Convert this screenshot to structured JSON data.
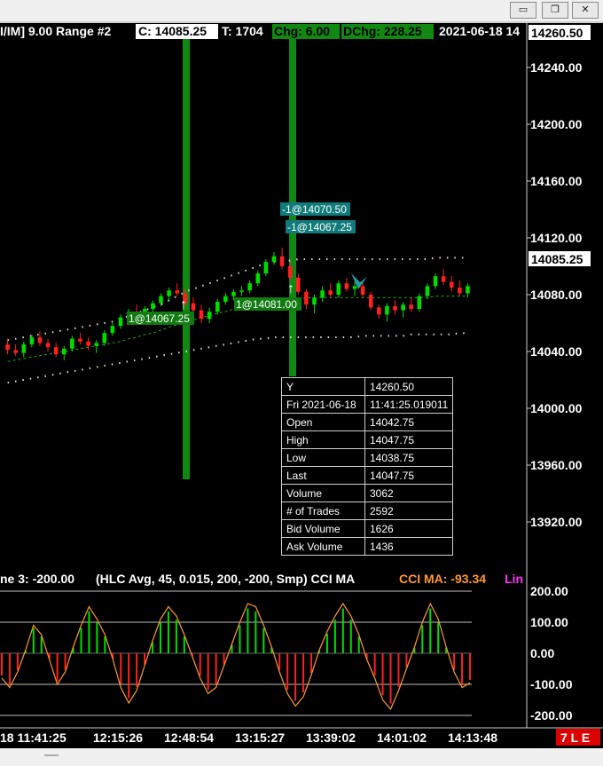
{
  "window": {
    "minimize_glyph": "▭",
    "restore_glyph": "❐",
    "close_glyph": "✕"
  },
  "header": {
    "title": "I/IM]  9.00 Range #2",
    "close": "C: 14085.25",
    "trades": "T: 1704",
    "chg": "Chg: 6.00",
    "dchg": "DChg: 228.25",
    "date": "2021-06-18 14"
  },
  "price_axis": {
    "ticks": [
      "14240.00",
      "14200.00",
      "14160.00",
      "14120.00",
      "14080.00",
      "14040.00",
      "14000.00",
      "13960.00",
      "13920.00"
    ],
    "top_label": "14260.50",
    "last_label": "14085.25"
  },
  "markers": {
    "sell_1": "-1@14070.50",
    "sell_2": "-1@14067.25",
    "buy_1": "1@14067.25",
    "buy_2": "1@14081.00"
  },
  "tooltip": {
    "rows": [
      [
        "Y",
        "14260.50"
      ],
      [
        "Fri 2021-06-18",
        "11:41:25.019011"
      ],
      [
        "Open",
        "14042.75"
      ],
      [
        "High",
        "14047.75"
      ],
      [
        "Low",
        "14038.75"
      ],
      [
        "Last",
        "14047.75"
      ],
      [
        "Volume",
        "3062"
      ],
      [
        "# of Trades",
        "2592"
      ],
      [
        "Bid Volume",
        "1626"
      ],
      [
        "Ask Volume",
        "1436"
      ]
    ]
  },
  "indicator": {
    "line3": "ne 3: -200.00",
    "params": "(HLC Avg, 45, 0.015, 200, -200, Smp)  CCI MA",
    "cci_ma": "CCI MA: -93.34",
    "lin": "Lin",
    "ticks": [
      "200.00",
      "100.00",
      "0.00",
      "-100.00",
      "-200.00"
    ]
  },
  "time_axis": {
    "labels": [
      "18  11:41:25",
      "12:15:26",
      "12:48:54",
      "13:15:27",
      "13:39:02",
      "14:01:02",
      "14:13:48"
    ]
  },
  "badge": "7 L E",
  "colors": {
    "up": "#00dd00",
    "down": "#ff2020",
    "highlight_bar": "#118811",
    "marker_sell": "#117a7a",
    "marker_buy": "#117a11",
    "cci_line": "#ff9933",
    "grid": "#c0c0c0"
  },
  "chart_data": {
    "type": "candlestick",
    "price_range": [
      13900,
      14270
    ],
    "cci_range": [
      -200,
      200
    ],
    "price_ticks": [
      14240,
      14200,
      14160,
      14120,
      14080,
      14040,
      14000,
      13960,
      13920
    ],
    "cci_ticks": [
      200,
      100,
      0,
      -100,
      -200
    ],
    "candles": [
      [
        14045,
        14049,
        14038,
        14041
      ],
      [
        14041,
        14045,
        14037,
        14039
      ],
      [
        14039,
        14047,
        14036,
        14045
      ],
      [
        14045,
        14052,
        14043,
        14050
      ],
      [
        14050,
        14054,
        14044,
        14046
      ],
      [
        14046,
        14049,
        14040,
        14043
      ],
      [
        14043,
        14046,
        14036,
        14038
      ],
      [
        14038,
        14044,
        14034,
        14042
      ],
      [
        14042,
        14051,
        14040,
        14049
      ],
      [
        14049,
        14053,
        14045,
        14047
      ],
      [
        14047,
        14050,
        14041,
        14044
      ],
      [
        14044,
        14048,
        14039,
        14046
      ],
      [
        14046,
        14055,
        14044,
        14053
      ],
      [
        14053,
        14060,
        14051,
        14058
      ],
      [
        14058,
        14066,
        14056,
        14064
      ],
      [
        14064,
        14070,
        14061,
        14068
      ],
      [
        14068,
        14073,
        14063,
        14066
      ],
      [
        14066,
        14072,
        14064,
        14070
      ],
      [
        14070,
        14076,
        14068,
        14074
      ],
      [
        14074,
        14081,
        14072,
        14079
      ],
      [
        14079,
        14085,
        14076,
        14083
      ],
      [
        14083,
        14088,
        14079,
        14081
      ],
      [
        14081,
        14084,
        14072,
        14074
      ],
      [
        14074,
        14078,
        14066,
        14069
      ],
      [
        14069,
        14073,
        14060,
        14063
      ],
      [
        14063,
        14071,
        14060,
        14068
      ],
      [
        14068,
        14077,
        14066,
        14075
      ],
      [
        14075,
        14081,
        14073,
        14079
      ],
      [
        14079,
        14084,
        14076,
        14082
      ],
      [
        14082,
        14086,
        14079,
        14083
      ],
      [
        14083,
        14090,
        14081,
        14088
      ],
      [
        14088,
        14097,
        14086,
        14095
      ],
      [
        14095,
        14105,
        14093,
        14103
      ],
      [
        14103,
        14110,
        14101,
        14107
      ],
      [
        14107,
        14113,
        14098,
        14100
      ],
      [
        14100,
        14103,
        14090,
        14092
      ],
      [
        14092,
        14095,
        14080,
        14082
      ],
      [
        14082,
        14084,
        14070,
        14073
      ],
      [
        14073,
        14080,
        14067,
        14078
      ],
      [
        14078,
        14086,
        14075,
        14083
      ],
      [
        14083,
        14088,
        14078,
        14080
      ],
      [
        14080,
        14090,
        14078,
        14088
      ],
      [
        14088,
        14092,
        14082,
        14084
      ],
      [
        14084,
        14089,
        14079,
        14086
      ],
      [
        14086,
        14090,
        14078,
        14080
      ],
      [
        14080,
        14082,
        14069,
        14071
      ],
      [
        14071,
        14073,
        14063,
        14066
      ],
      [
        14066,
        14074,
        14061,
        14072
      ],
      [
        14072,
        14076,
        14066,
        14069
      ],
      [
        14069,
        14075,
        14064,
        14073
      ],
      [
        14073,
        14078,
        14068,
        14070
      ],
      [
        14070,
        14081,
        14068,
        14079
      ],
      [
        14079,
        14088,
        14077,
        14086
      ],
      [
        14086,
        14095,
        14084,
        14093
      ],
      [
        14093,
        14098,
        14087,
        14089
      ],
      [
        14089,
        14093,
        14082,
        14085
      ],
      [
        14085,
        14090,
        14079,
        14081
      ],
      [
        14081,
        14088,
        14078,
        14086
      ]
    ],
    "upper_band": [
      14048,
      14049,
      14050,
      14051,
      14052,
      14053,
      14054,
      14055,
      14056,
      14057,
      14058,
      14059,
      14060,
      14061,
      14063,
      14065,
      14067,
      14069,
      14071,
      14073,
      14076,
      14079,
      14082,
      14084,
      14086,
      14088,
      14090,
      14092,
      14094,
      14096,
      14098,
      14100,
      14102,
      14103,
      14104,
      14104,
      14105,
      14105,
      14105,
      14105,
      14105,
      14105,
      14105,
      14105,
      14105,
      14105,
      14105,
      14105,
      14105,
      14105,
      14105,
      14105,
      14105,
      14106,
      14106,
      14106,
      14106,
      14106
    ],
    "lower_band": [
      14018,
      14019,
      14020,
      14021,
      14022,
      14023,
      14024,
      14025,
      14026,
      14027,
      14028,
      14029,
      14030,
      14031,
      14032,
      14033,
      14034,
      14035,
      14036,
      14037,
      14038,
      14039,
      14040,
      14041,
      14042,
      14043,
      14044,
      14045,
      14046,
      14047,
      14048,
      14049,
      14049,
      14050,
      14050,
      14050,
      14050,
      14050,
      14050,
      14050,
      14050,
      14050,
      14050,
      14050,
      14051,
      14051,
      14051,
      14051,
      14051,
      14051,
      14052,
      14052,
      14052,
      14052,
      14052,
      14052,
      14053,
      14053
    ],
    "mid_band": [
      14033,
      14034,
      14035,
      14036,
      14037,
      14038,
      14039,
      14040,
      14041,
      14042,
      14043,
      14044,
      14045,
      14046,
      14047,
      14049,
      14050,
      14052,
      14053,
      14055,
      14057,
      14059,
      14061,
      14062,
      14064,
      14065,
      14067,
      14068,
      14070,
      14071,
      14073,
      14074,
      14075,
      14076,
      14077,
      14077,
      14077,
      14078,
      14078,
      14078,
      14078,
      14078,
      14078,
      14078,
      14078,
      14078,
      14078,
      14078,
      14078,
      14078,
      14078,
      14078,
      14078,
      14079,
      14079,
      14079,
      14079,
      14079
    ],
    "cci_ma": [
      -80,
      -110,
      -60,
      10,
      90,
      60,
      -20,
      -100,
      -60,
      20,
      90,
      150,
      110,
      60,
      -20,
      -110,
      -160,
      -120,
      -40,
      40,
      110,
      150,
      120,
      60,
      -10,
      -80,
      -130,
      -110,
      -40,
      30,
      100,
      160,
      150,
      90,
      20,
      -60,
      -130,
      -170,
      -140,
      -70,
      10,
      70,
      120,
      160,
      120,
      60,
      -20,
      -80,
      -150,
      -180,
      -120,
      -50,
      20,
      100,
      160,
      110,
      20,
      -60,
      -110,
      -95
    ]
  }
}
